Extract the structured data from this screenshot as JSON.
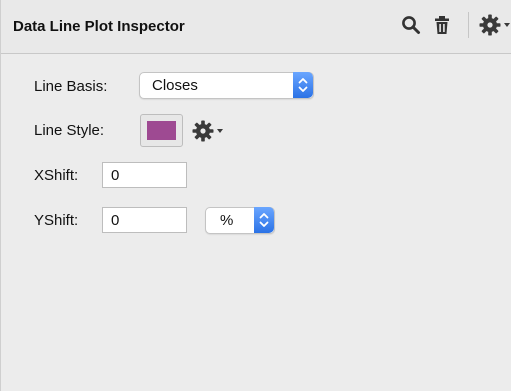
{
  "inspector": {
    "title": "Data Line Plot Inspector",
    "icons": {
      "search": "search-icon",
      "delete": "trash-icon",
      "settings": "gear-icon"
    }
  },
  "form": {
    "line_basis": {
      "label": "Line Basis:",
      "selected": "Closes"
    },
    "line_style": {
      "label": "Line Style:",
      "color": "#9e4a92",
      "settings_icon": "gear-icon"
    },
    "xshift": {
      "label": "XShift:",
      "value": "0"
    },
    "yshift": {
      "label": "YShift:",
      "value": "0",
      "unit_selected": "%"
    }
  },
  "colors": {
    "accent_stepper": "#2b72e6"
  }
}
